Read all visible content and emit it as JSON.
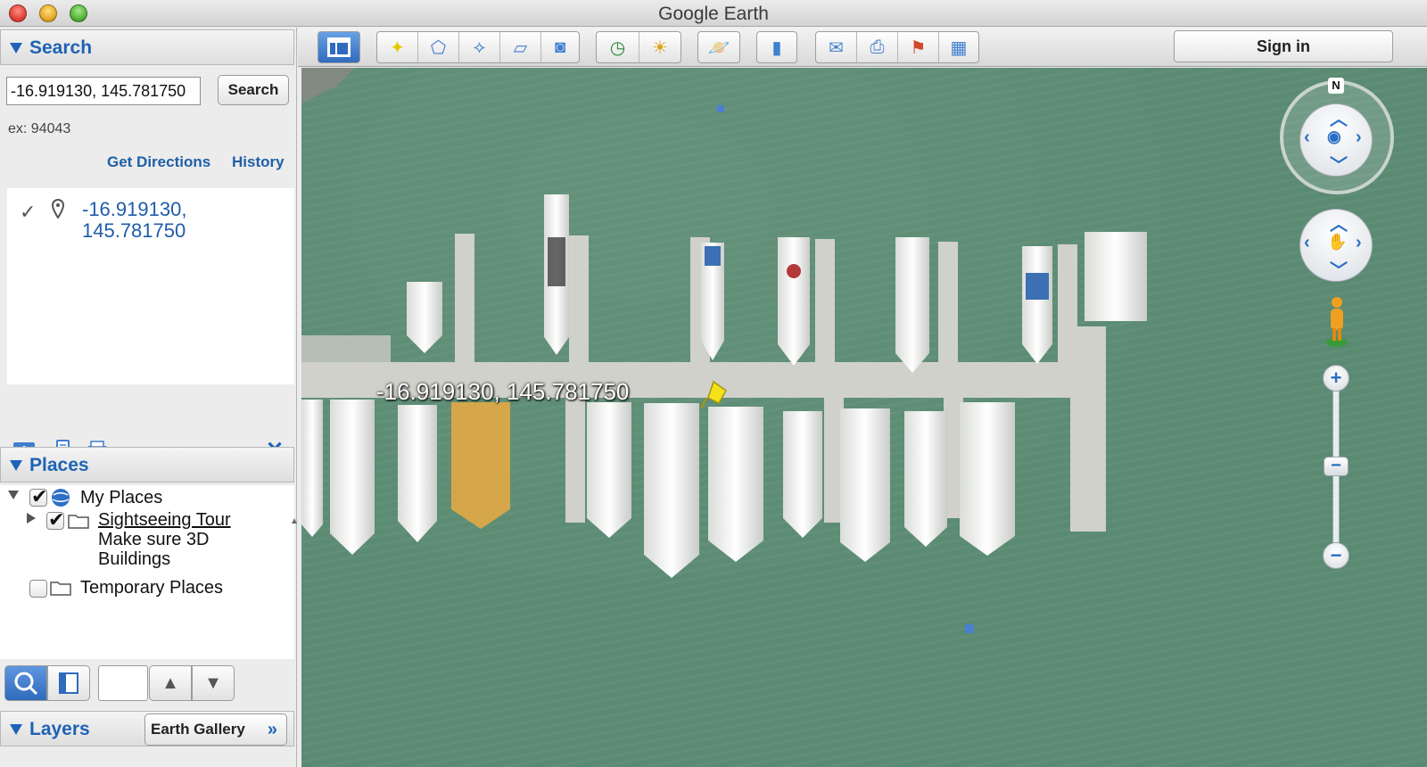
{
  "window": {
    "title": "Google Earth"
  },
  "search": {
    "heading": "Search",
    "query_value": "-16.919130, 145.781750",
    "button_label": "Search",
    "hint": "ex: 94043",
    "get_directions": "Get Directions",
    "history": "History",
    "result_text": "-16.919130, 145.781750"
  },
  "places": {
    "heading": "Places",
    "items": [
      {
        "label": "My Places",
        "checked": true
      },
      {
        "label": "Sightseeing Tour",
        "checked": true,
        "note": "Make sure 3D Buildings"
      },
      {
        "label": "Temporary Places",
        "checked": false
      }
    ]
  },
  "layers": {
    "heading": "Layers",
    "earth_gallery": "Earth Gallery",
    "earth_gallery_chevron": "»"
  },
  "toolbar": {
    "sign_in": "Sign in",
    "icons": [
      "sidebar-toggle-icon",
      "add-placemark-icon",
      "add-polygon-icon",
      "add-path-icon",
      "add-image-overlay-icon",
      "record-tour-icon",
      "historical-imagery-icon",
      "sunlight-icon",
      "planets-icon",
      "ruler-icon",
      "email-icon",
      "print-icon",
      "view-in-maps-icon",
      "save-image-icon"
    ]
  },
  "map": {
    "placemark_label": "-16.919130, 145.781750",
    "water_color": "#5a8a72",
    "placemark_color": "#f3e21a"
  },
  "navigation": {
    "north": "N",
    "zoom_in": "+",
    "zoom_out": "−",
    "slider": "−"
  }
}
